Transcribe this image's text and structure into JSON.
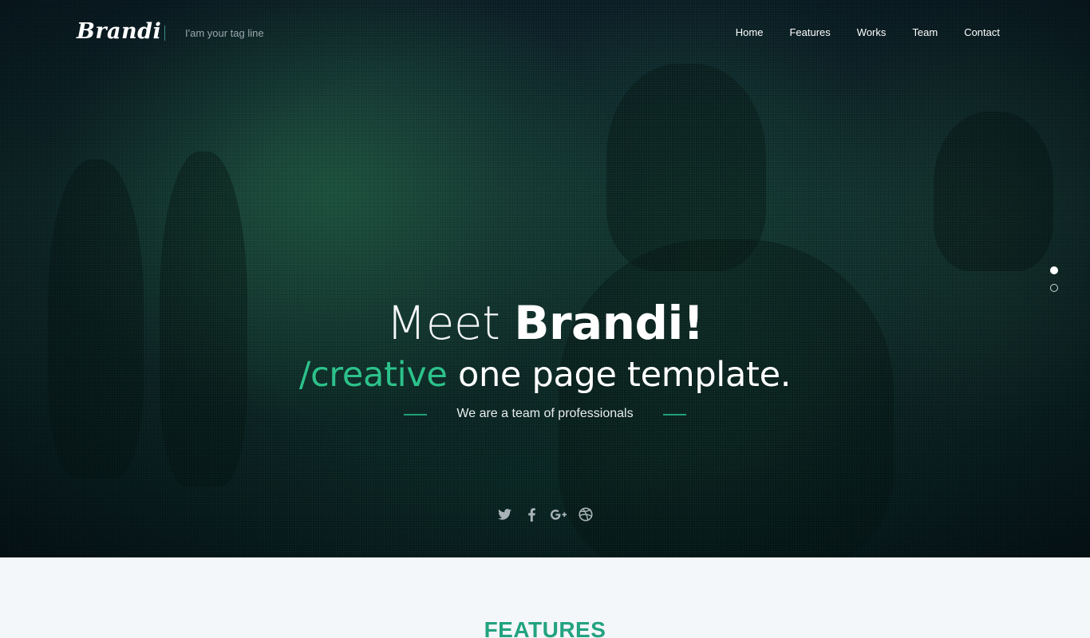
{
  "header": {
    "logo": "Brandi",
    "tagline": "I'am your tag line",
    "nav": [
      "Home",
      "Features",
      "Works",
      "Team",
      "Contact"
    ]
  },
  "hero": {
    "headline_light": "Meet ",
    "headline_bold": "Brandi!",
    "subheadline_accent": "/creative",
    "subheadline_rest": " one page template.",
    "tagline": "We are a team of professionals",
    "slides": {
      "count": 2,
      "active": 1
    },
    "social_icons": [
      "twitter-icon",
      "facebook-icon",
      "google-plus-icon",
      "dribbble-icon"
    ]
  },
  "features": {
    "title": "FEATURES"
  },
  "colors": {
    "accent": "#2cc28b",
    "features_title": "#23a380",
    "hero_dark": "#0c2424",
    "section_bg": "#f4f7fa"
  }
}
